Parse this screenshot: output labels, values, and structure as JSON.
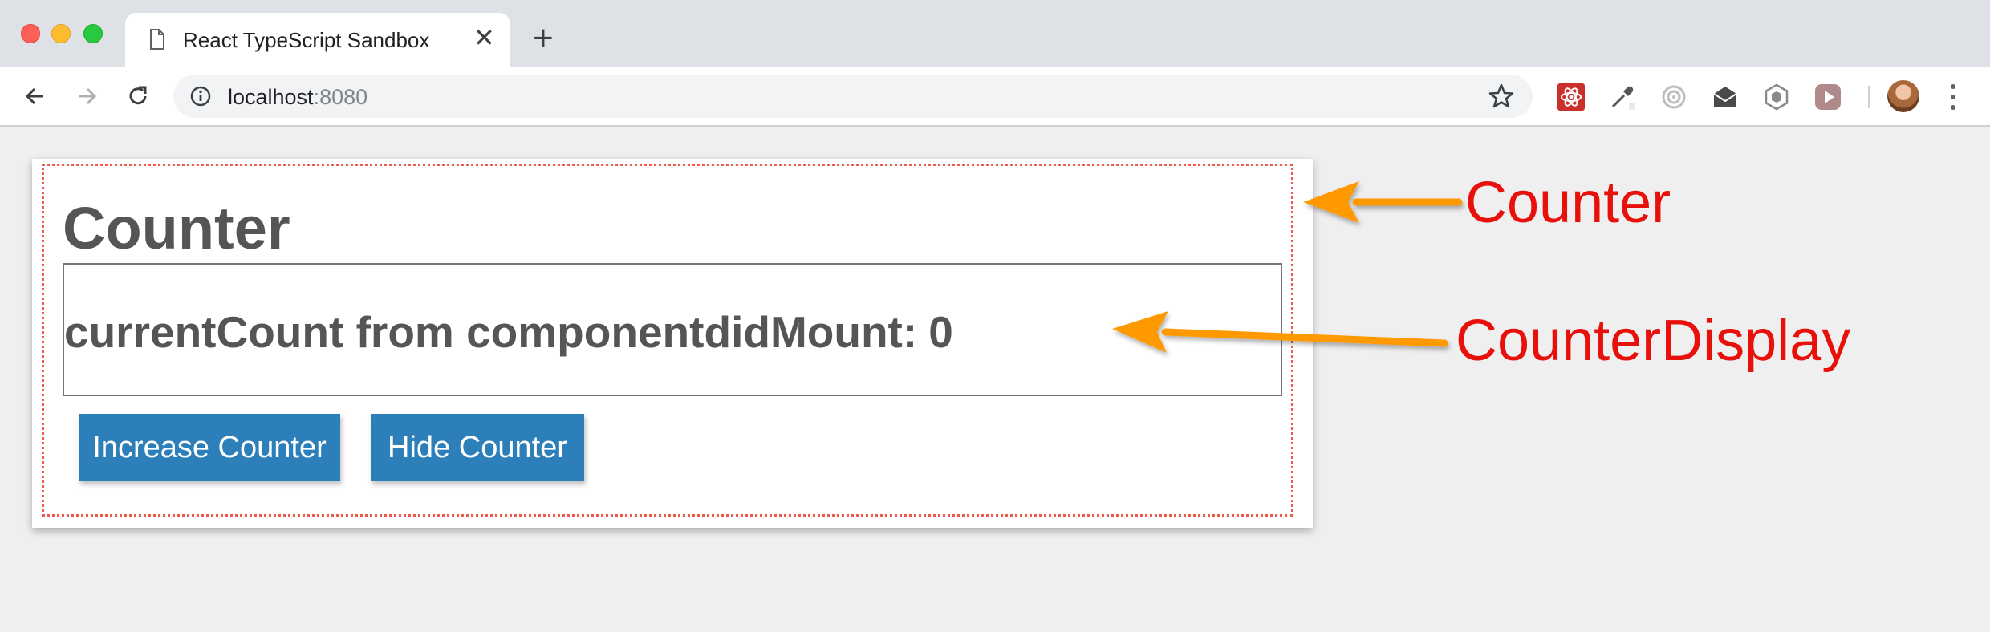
{
  "browser": {
    "tab": {
      "title": "React TypeScript Sandbox",
      "close_glyph": "✕"
    },
    "new_tab_glyph": "+",
    "address": {
      "host": "localhost",
      "port": ":8080"
    },
    "extensions": [
      "react-devtools-icon",
      "eyedropper-icon",
      "target-icon",
      "mail-icon",
      "hexagon-icon",
      "play-icon"
    ]
  },
  "page": {
    "heading": "Counter",
    "display_label": "currentCount from componentdidMount:",
    "current_count": "0",
    "buttons": {
      "increase": "Increase Counter",
      "hide": "Hide Counter"
    }
  },
  "annotations": {
    "counter": "Counter",
    "counter_display": "CounterDisplay",
    "label_color": "#e8100b",
    "arrow_color": "#ff9900"
  },
  "colors": {
    "button_bg": "#2d7fb9",
    "dotted_border": "#f05a4a",
    "heading_text": "#555555"
  }
}
